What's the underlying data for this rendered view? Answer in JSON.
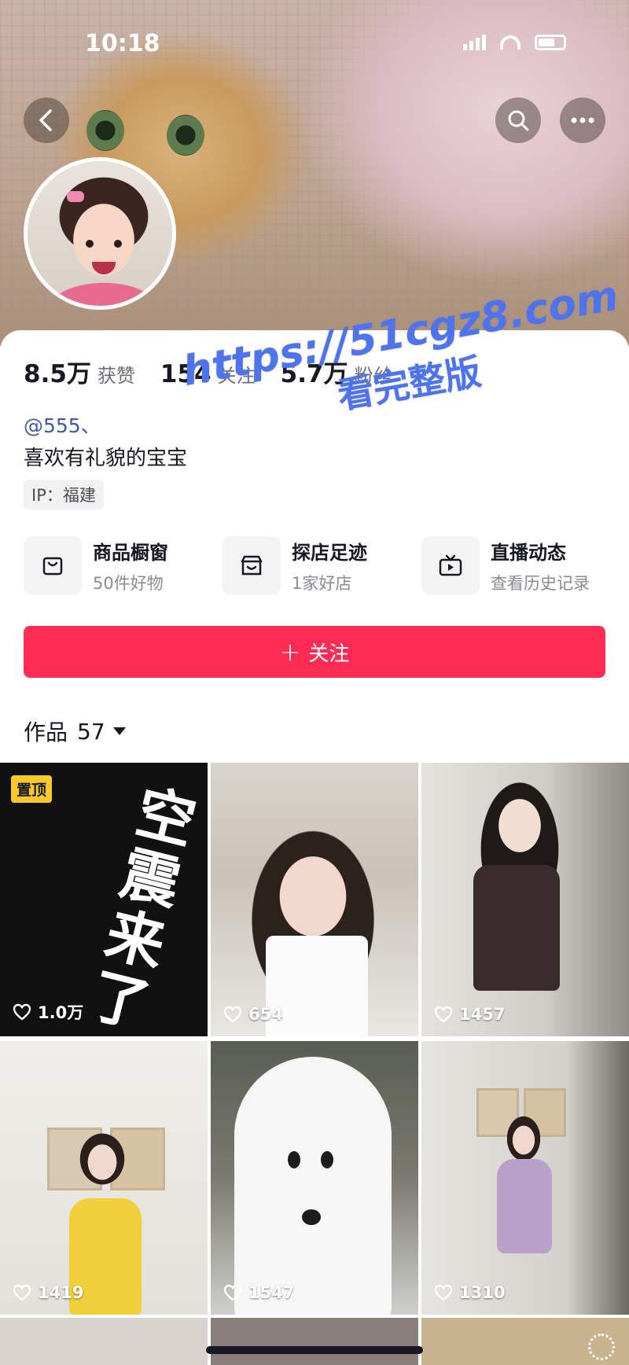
{
  "status_bar": {
    "time": "10:18"
  },
  "profile": {
    "stats": [
      {
        "value": "8.5万",
        "label": "获赞"
      },
      {
        "value": "154",
        "label": "关注"
      },
      {
        "value": "5.7万",
        "label": "粉丝"
      }
    ],
    "handle": "@555、",
    "bio": "喜欢有礼貌的宝宝",
    "ip": "IP：福建"
  },
  "watermark": {
    "line1": "https://51cgz8.com",
    "line2": "看完整版"
  },
  "features": [
    {
      "icon": "shopping-bag-icon",
      "title": "商品橱窗",
      "subtitle": "50件好物"
    },
    {
      "icon": "store-icon",
      "title": "探店足迹",
      "subtitle": "1家好店"
    },
    {
      "icon": "tv-icon",
      "title": "直播动态",
      "subtitle": "查看历史记录"
    }
  ],
  "follow_button": {
    "plus": "+",
    "label": "关注"
  },
  "works": {
    "label": "作品",
    "count": "57"
  },
  "tiles": [
    {
      "pinned_label": "置顶",
      "vertical_text": "空震来了",
      "likes": "1.0万"
    },
    {
      "likes": "654"
    },
    {
      "likes": "1457"
    },
    {
      "likes": "1419"
    },
    {
      "likes": "1547"
    },
    {
      "likes": "1310"
    }
  ],
  "colors": {
    "accent": "#fe2c55",
    "handle": "#3d5aa8",
    "watermark": "#4f73ea",
    "pin": "#f8c92a"
  }
}
